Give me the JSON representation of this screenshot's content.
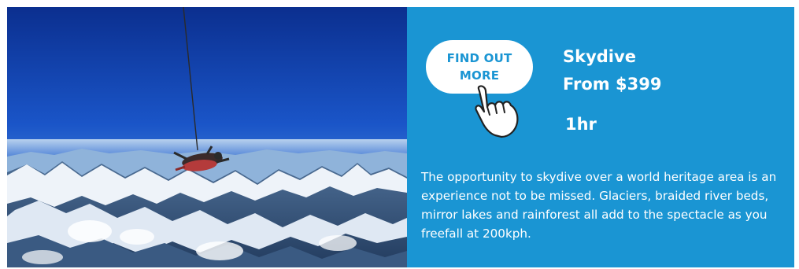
{
  "tour": {
    "image_alt": "Tandem skydivers in freefall above snow-capped mountains",
    "cta_label": "FIND OUT MORE",
    "title": "Skydive",
    "price": "From $399",
    "duration": "1hr",
    "description": "The opportunity to skydive over a world heritage area is an experience not to be missed. Glaciers, braided river beds, mirror lakes and rainforest all add to the spectacle as you freefall at 200kph."
  },
  "icons": {
    "cta_icon": "pointing-hand-icon"
  },
  "colors": {
    "panel": "#1a95d3",
    "button_bg": "#ffffff",
    "button_text": "#1a95d3",
    "text": "#ffffff"
  }
}
